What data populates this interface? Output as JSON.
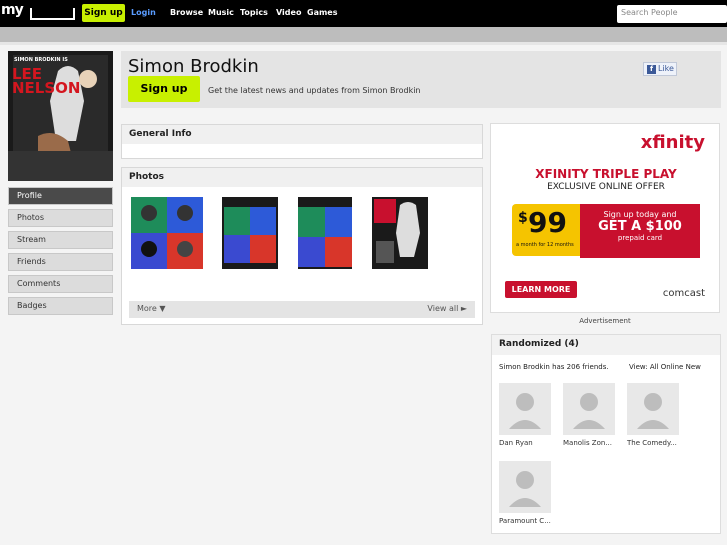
{
  "topbar": {
    "logo": "my",
    "signup": "Sign up",
    "login": "Login",
    "nav": [
      "Browse",
      "Music",
      "Topics",
      "Video",
      "Games"
    ],
    "search_placeholder": "Search People"
  },
  "profile": {
    "name": "Simon Brodkin",
    "signup": "Sign up",
    "tagline": "Get the latest news and updates from Simon Brodkin",
    "like": "Like"
  },
  "sidebar": {
    "items": [
      "Profile",
      "Photos",
      "Stream",
      "Friends",
      "Comments",
      "Badges"
    ]
  },
  "sections": {
    "general_info": "General Info",
    "photos": "Photos",
    "more": "More ▼",
    "view_all": "View all ►"
  },
  "ad": {
    "brand": "xfinity",
    "headline": "XFINITY TRIPLE PLAY",
    "subhead": "EXCLUSIVE ONLINE OFFER",
    "price_dollar": "$",
    "price": "99",
    "price_note": "a month for 12 months",
    "offer_line1": "Sign up today and",
    "offer_line2": "GET A $100",
    "offer_line3": "prepaid card",
    "cta": "LEARN MORE",
    "partner": "comcast",
    "label": "Advertisement"
  },
  "randomized": {
    "title": "Randomized (4)",
    "summary_prefix": "Simon Brodkin has ",
    "summary_count": "206",
    "summary_suffix": " friends.",
    "view_label": "View:",
    "view_all": "All",
    "view_online": "Online",
    "view_new": "New",
    "friends": [
      "Dan Ryan",
      "Manolis Zon...",
      "The Comedy...",
      "Paramount C..."
    ]
  },
  "poster": {
    "top_text": "SIMON BRODKIN IS",
    "big_text": "LEE NELSON"
  },
  "colors": {
    "accent": "#c8f000",
    "ad_red": "#c8102e",
    "link_blue": "#5a9cff"
  }
}
